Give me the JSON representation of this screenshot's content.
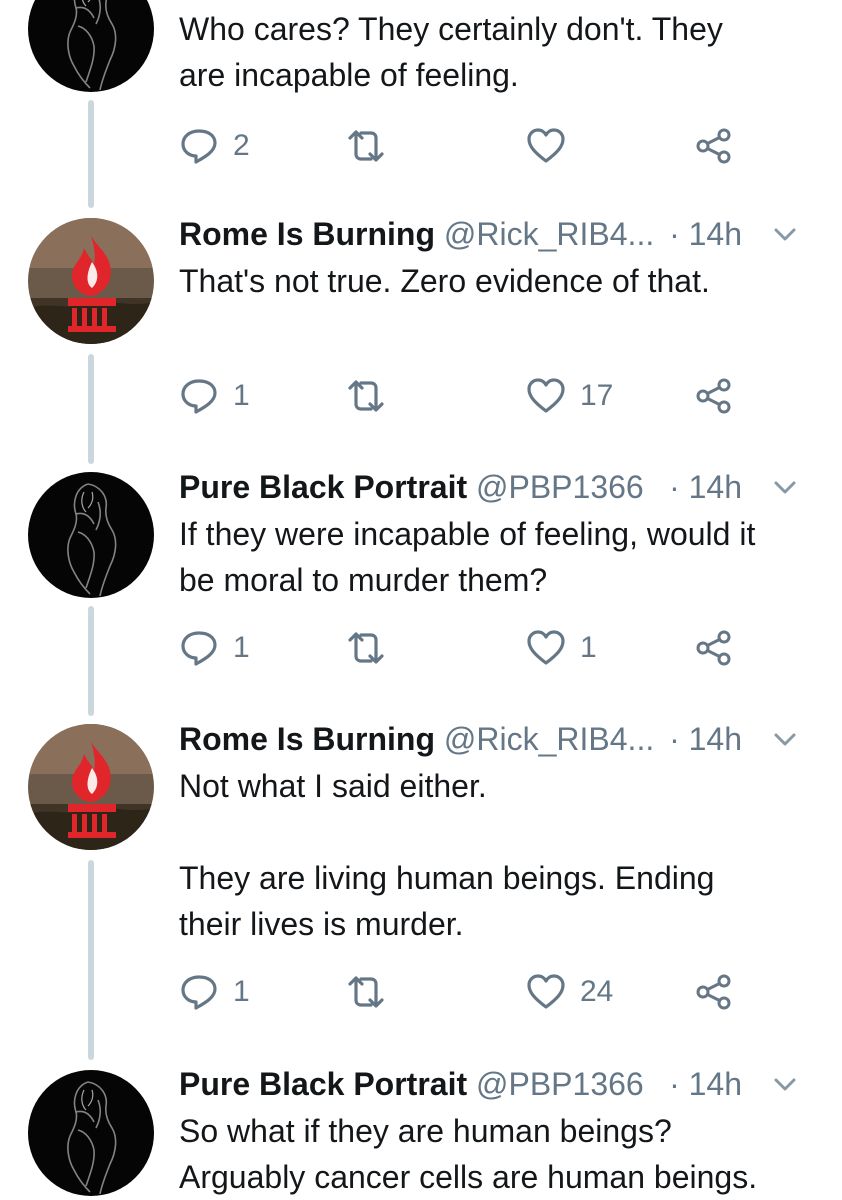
{
  "tweets": [
    {
      "name": "",
      "handle": "",
      "time": "",
      "text": "Who cares? They certainly don't. They\nare incapable of feeling.",
      "replies": "2",
      "retweets": "",
      "likes": ""
    },
    {
      "name": "Rome Is Burning",
      "handle": "@Rick_RIB4...",
      "time": "· 14h",
      "text": "That's not true. Zero evidence of that.",
      "replies": "1",
      "retweets": "",
      "likes": "17"
    },
    {
      "name": "Pure Black Portrait",
      "handle": "@PBP1366",
      "time": "· 14h",
      "text": "If they were incapable of feeling, would it\nbe moral to murder them?",
      "replies": "1",
      "retweets": "",
      "likes": "1"
    },
    {
      "name": "Rome Is Burning",
      "handle": "@Rick_RIB4...",
      "time": "· 14h",
      "text": "Not what I said either.\n\nThey are living human beings. Ending\ntheir lives is murder.",
      "replies": "1",
      "retweets": "",
      "likes": "24"
    },
    {
      "name": "Pure Black Portrait",
      "handle": "@PBP1366",
      "time": "· 14h",
      "text": "So what if they are human beings?\nArguably cancer cells are human beings.",
      "replies": "",
      "retweets": "",
      "likes": ""
    }
  ],
  "icons": {
    "reply": "reply-icon",
    "retweet": "retweet-icon",
    "like": "heart-icon",
    "share": "share-icon",
    "more": "chevron-down-icon"
  },
  "colors": {
    "icon": "#657786",
    "thread_line": "#ccd6dd",
    "name": "#14171a",
    "meta": "#657786",
    "flame": "#e0262b"
  }
}
